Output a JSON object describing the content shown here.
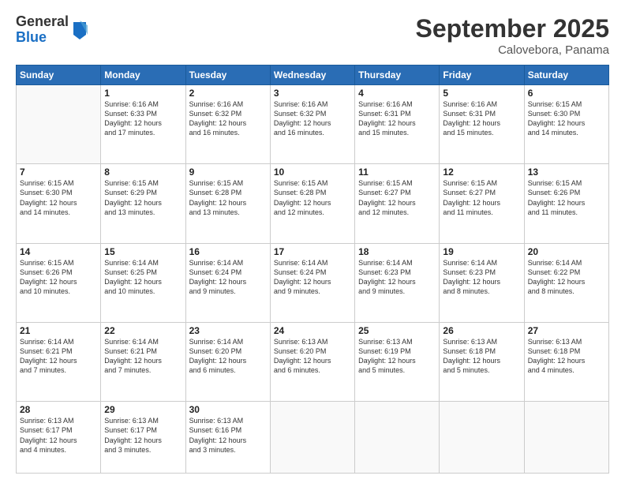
{
  "header": {
    "logo_general": "General",
    "logo_blue": "Blue",
    "title": "September 2025",
    "location": "Calovebora, Panama"
  },
  "weekdays": [
    "Sunday",
    "Monday",
    "Tuesday",
    "Wednesday",
    "Thursday",
    "Friday",
    "Saturday"
  ],
  "weeks": [
    [
      {
        "day": "",
        "info": ""
      },
      {
        "day": "1",
        "info": "Sunrise: 6:16 AM\nSunset: 6:33 PM\nDaylight: 12 hours\nand 17 minutes."
      },
      {
        "day": "2",
        "info": "Sunrise: 6:16 AM\nSunset: 6:32 PM\nDaylight: 12 hours\nand 16 minutes."
      },
      {
        "day": "3",
        "info": "Sunrise: 6:16 AM\nSunset: 6:32 PM\nDaylight: 12 hours\nand 16 minutes."
      },
      {
        "day": "4",
        "info": "Sunrise: 6:16 AM\nSunset: 6:31 PM\nDaylight: 12 hours\nand 15 minutes."
      },
      {
        "day": "5",
        "info": "Sunrise: 6:16 AM\nSunset: 6:31 PM\nDaylight: 12 hours\nand 15 minutes."
      },
      {
        "day": "6",
        "info": "Sunrise: 6:15 AM\nSunset: 6:30 PM\nDaylight: 12 hours\nand 14 minutes."
      }
    ],
    [
      {
        "day": "7",
        "info": "Sunrise: 6:15 AM\nSunset: 6:30 PM\nDaylight: 12 hours\nand 14 minutes."
      },
      {
        "day": "8",
        "info": "Sunrise: 6:15 AM\nSunset: 6:29 PM\nDaylight: 12 hours\nand 13 minutes."
      },
      {
        "day": "9",
        "info": "Sunrise: 6:15 AM\nSunset: 6:28 PM\nDaylight: 12 hours\nand 13 minutes."
      },
      {
        "day": "10",
        "info": "Sunrise: 6:15 AM\nSunset: 6:28 PM\nDaylight: 12 hours\nand 12 minutes."
      },
      {
        "day": "11",
        "info": "Sunrise: 6:15 AM\nSunset: 6:27 PM\nDaylight: 12 hours\nand 12 minutes."
      },
      {
        "day": "12",
        "info": "Sunrise: 6:15 AM\nSunset: 6:27 PM\nDaylight: 12 hours\nand 11 minutes."
      },
      {
        "day": "13",
        "info": "Sunrise: 6:15 AM\nSunset: 6:26 PM\nDaylight: 12 hours\nand 11 minutes."
      }
    ],
    [
      {
        "day": "14",
        "info": "Sunrise: 6:15 AM\nSunset: 6:26 PM\nDaylight: 12 hours\nand 10 minutes."
      },
      {
        "day": "15",
        "info": "Sunrise: 6:14 AM\nSunset: 6:25 PM\nDaylight: 12 hours\nand 10 minutes."
      },
      {
        "day": "16",
        "info": "Sunrise: 6:14 AM\nSunset: 6:24 PM\nDaylight: 12 hours\nand 9 minutes."
      },
      {
        "day": "17",
        "info": "Sunrise: 6:14 AM\nSunset: 6:24 PM\nDaylight: 12 hours\nand 9 minutes."
      },
      {
        "day": "18",
        "info": "Sunrise: 6:14 AM\nSunset: 6:23 PM\nDaylight: 12 hours\nand 9 minutes."
      },
      {
        "day": "19",
        "info": "Sunrise: 6:14 AM\nSunset: 6:23 PM\nDaylight: 12 hours\nand 8 minutes."
      },
      {
        "day": "20",
        "info": "Sunrise: 6:14 AM\nSunset: 6:22 PM\nDaylight: 12 hours\nand 8 minutes."
      }
    ],
    [
      {
        "day": "21",
        "info": "Sunrise: 6:14 AM\nSunset: 6:21 PM\nDaylight: 12 hours\nand 7 minutes."
      },
      {
        "day": "22",
        "info": "Sunrise: 6:14 AM\nSunset: 6:21 PM\nDaylight: 12 hours\nand 7 minutes."
      },
      {
        "day": "23",
        "info": "Sunrise: 6:14 AM\nSunset: 6:20 PM\nDaylight: 12 hours\nand 6 minutes."
      },
      {
        "day": "24",
        "info": "Sunrise: 6:13 AM\nSunset: 6:20 PM\nDaylight: 12 hours\nand 6 minutes."
      },
      {
        "day": "25",
        "info": "Sunrise: 6:13 AM\nSunset: 6:19 PM\nDaylight: 12 hours\nand 5 minutes."
      },
      {
        "day": "26",
        "info": "Sunrise: 6:13 AM\nSunset: 6:18 PM\nDaylight: 12 hours\nand 5 minutes."
      },
      {
        "day": "27",
        "info": "Sunrise: 6:13 AM\nSunset: 6:18 PM\nDaylight: 12 hours\nand 4 minutes."
      }
    ],
    [
      {
        "day": "28",
        "info": "Sunrise: 6:13 AM\nSunset: 6:17 PM\nDaylight: 12 hours\nand 4 minutes."
      },
      {
        "day": "29",
        "info": "Sunrise: 6:13 AM\nSunset: 6:17 PM\nDaylight: 12 hours\nand 3 minutes."
      },
      {
        "day": "30",
        "info": "Sunrise: 6:13 AM\nSunset: 6:16 PM\nDaylight: 12 hours\nand 3 minutes."
      },
      {
        "day": "",
        "info": ""
      },
      {
        "day": "",
        "info": ""
      },
      {
        "day": "",
        "info": ""
      },
      {
        "day": "",
        "info": ""
      }
    ]
  ]
}
